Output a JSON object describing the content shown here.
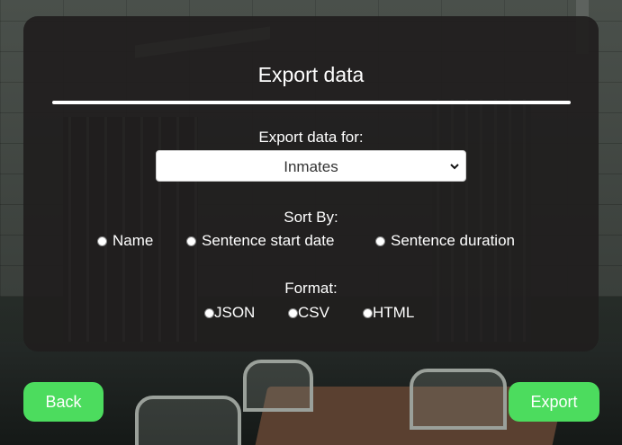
{
  "dialog": {
    "title": "Export data",
    "export_for_label": "Export data for:",
    "export_for_selected": "Inmates",
    "sort_by_label": "Sort By:",
    "sort_options": [
      "Name",
      "Sentence start date",
      "Sentence duration"
    ],
    "format_label": "Format:",
    "format_options": [
      "JSON",
      "CSV",
      "HTML"
    ]
  },
  "buttons": {
    "back": "Back",
    "export": "Export"
  },
  "colors": {
    "accent": "#4cdc5e",
    "panel": "#201e1e"
  }
}
